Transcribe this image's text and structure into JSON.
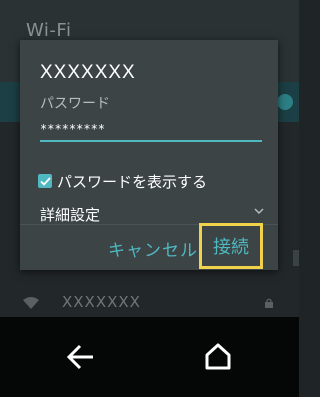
{
  "background": {
    "title": "Wi-Fi",
    "network_row": {
      "ssid": "XXXXXXX",
      "icon": "wifi-icon",
      "lock_icon": "lock-icon"
    }
  },
  "dialog": {
    "ssid": "XXXXXXX",
    "password_label": "パスワード",
    "password_value": "*********",
    "show_password": {
      "label": "パスワードを表示する",
      "checked": true
    },
    "advanced_label": "詳細設定",
    "cancel_label": "キャンセル",
    "connect_label": "接続"
  },
  "nav": {
    "back_icon": "back-arrow-icon",
    "home_icon": "home-icon"
  },
  "colors": {
    "accent": "#4fb8c1",
    "highlight": "#f1d34b",
    "dialog_bg": "#3c4446",
    "nav_bg": "#050606"
  }
}
